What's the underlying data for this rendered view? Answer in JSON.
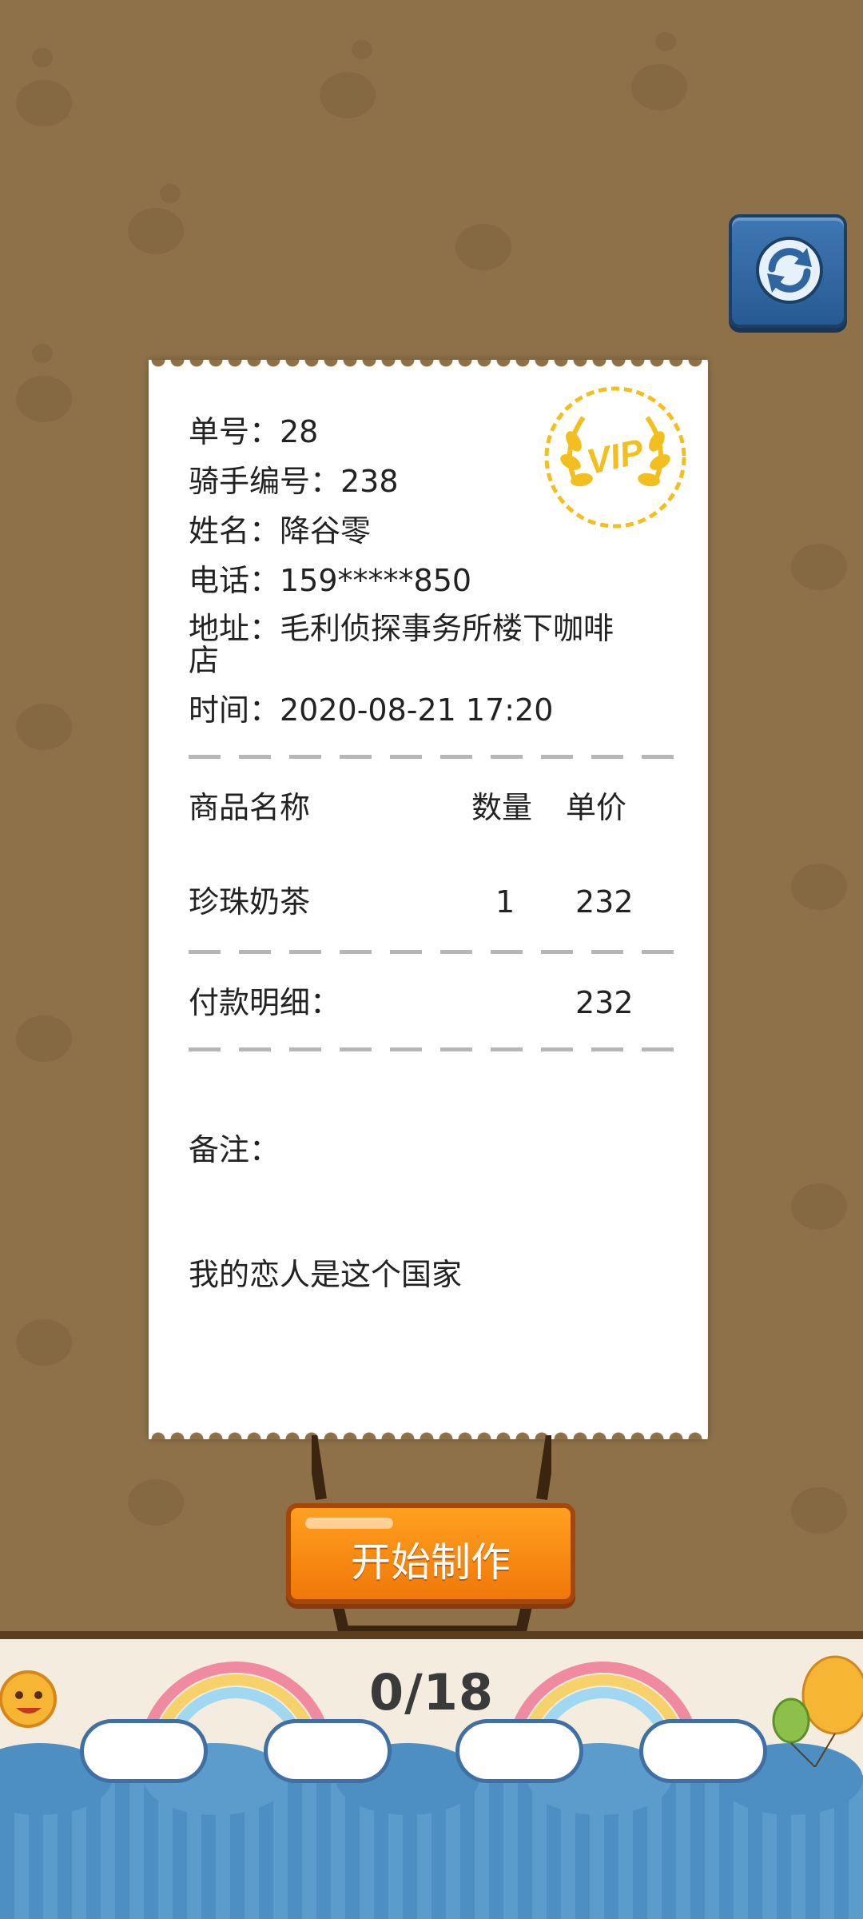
{
  "receipt": {
    "order_no": "单号：28",
    "rider_no": "骑手编号：238",
    "name": "姓名：降谷零",
    "phone": "电话：159*****850",
    "address_line1": "地址：毛利侦探事务所楼下咖啡",
    "address_line2": "店",
    "time": "时间：2020-08-21 17:20",
    "col_item": "商品名称",
    "col_qty": "数量",
    "col_price": "单价",
    "item_name": "珍珠奶茶",
    "item_qty": "1",
    "item_price": "232",
    "payment_label": "付款明细：",
    "payment_total": "232",
    "note_label": "备注：",
    "note_text": "我的恋人是这个国家",
    "badge": "VIP"
  },
  "start_button_label": "开始制作",
  "progress": "0/18",
  "icons": {
    "refresh": "refresh-icon",
    "badge": "vip-laurel-icon"
  },
  "colors": {
    "background": "#8e7148",
    "button": "#f07808",
    "refresh": "#2f65a0",
    "badge": "#f2bf1f"
  }
}
